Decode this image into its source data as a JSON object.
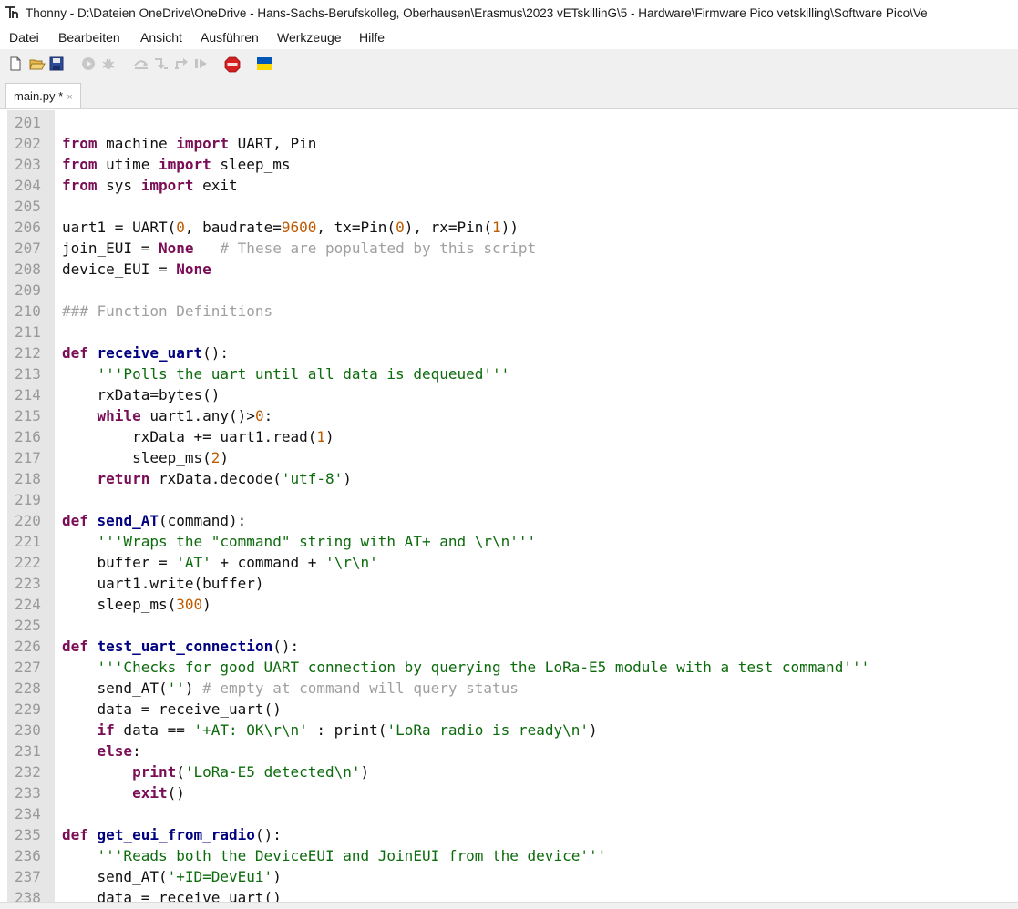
{
  "window": {
    "app_name": "Thonny",
    "title_path": "D:\\Dateien OneDrive\\OneDrive - Hans-Sachs-Berufskolleg, Oberhausen\\Erasmus\\2023 vETskillinG\\5 - Hardware\\Firmware Pico vetskilling\\Software Pico\\Ve",
    "separator": " - "
  },
  "menubar": {
    "items": [
      "Datei",
      "Bearbeiten",
      "Ansicht",
      "Ausführen",
      "Werkzeuge",
      "Hilfe"
    ]
  },
  "toolbar": {
    "icons": [
      "new-file",
      "open-file",
      "save",
      "run",
      "debug",
      "step-over",
      "step-into",
      "step-out",
      "resume",
      "stop",
      "ukraine-flag"
    ]
  },
  "tabs": [
    {
      "label": "main.py *",
      "close": "×",
      "active": true
    }
  ],
  "editor": {
    "lines": [
      {
        "n": "201",
        "tokens": []
      },
      {
        "n": "202",
        "tokens": [
          [
            "kw",
            "from"
          ],
          [
            "plain",
            " machine "
          ],
          [
            "kw",
            "import"
          ],
          [
            "plain",
            " UART, Pin"
          ]
        ]
      },
      {
        "n": "203",
        "tokens": [
          [
            "kw",
            "from"
          ],
          [
            "plain",
            " utime "
          ],
          [
            "kw",
            "import"
          ],
          [
            "plain",
            " sleep_ms"
          ]
        ]
      },
      {
        "n": "204",
        "tokens": [
          [
            "kw",
            "from"
          ],
          [
            "plain",
            " sys "
          ],
          [
            "kw",
            "import"
          ],
          [
            "plain",
            " exit"
          ]
        ]
      },
      {
        "n": "205",
        "tokens": []
      },
      {
        "n": "206",
        "tokens": [
          [
            "plain",
            "uart1 = UART("
          ],
          [
            "num",
            "0"
          ],
          [
            "plain",
            ", baudrate="
          ],
          [
            "num",
            "9600"
          ],
          [
            "plain",
            ", tx=Pin("
          ],
          [
            "num",
            "0"
          ],
          [
            "plain",
            "), rx=Pin("
          ],
          [
            "num",
            "1"
          ],
          [
            "plain",
            "))"
          ]
        ]
      },
      {
        "n": "207",
        "tokens": [
          [
            "plain",
            "join_EUI = "
          ],
          [
            "kw",
            "None"
          ],
          [
            "plain",
            "   "
          ],
          [
            "cmt",
            "# These are populated by this script"
          ]
        ]
      },
      {
        "n": "208",
        "tokens": [
          [
            "plain",
            "device_EUI = "
          ],
          [
            "kw",
            "None"
          ]
        ]
      },
      {
        "n": "209",
        "tokens": []
      },
      {
        "n": "210",
        "tokens": [
          [
            "cmt",
            "### Function Definitions"
          ]
        ]
      },
      {
        "n": "211",
        "tokens": []
      },
      {
        "n": "212",
        "tokens": [
          [
            "kw",
            "def"
          ],
          [
            "plain",
            " "
          ],
          [
            "fn",
            "receive_uart"
          ],
          [
            "plain",
            "():"
          ]
        ]
      },
      {
        "n": "213",
        "tokens": [
          [
            "plain",
            "    "
          ],
          [
            "str",
            "'''Polls the uart until all data is dequeued'''"
          ]
        ]
      },
      {
        "n": "214",
        "tokens": [
          [
            "plain",
            "    rxData=bytes()"
          ]
        ]
      },
      {
        "n": "215",
        "tokens": [
          [
            "plain",
            "    "
          ],
          [
            "kw",
            "while"
          ],
          [
            "plain",
            " uart1.any()>"
          ],
          [
            "num",
            "0"
          ],
          [
            "plain",
            ":"
          ]
        ]
      },
      {
        "n": "216",
        "tokens": [
          [
            "plain",
            "        rxData += uart1.read("
          ],
          [
            "num",
            "1"
          ],
          [
            "plain",
            ")"
          ]
        ]
      },
      {
        "n": "217",
        "tokens": [
          [
            "plain",
            "        sleep_ms("
          ],
          [
            "num",
            "2"
          ],
          [
            "plain",
            ")"
          ]
        ]
      },
      {
        "n": "218",
        "tokens": [
          [
            "plain",
            "    "
          ],
          [
            "kw",
            "return"
          ],
          [
            "plain",
            " rxData.decode("
          ],
          [
            "str",
            "'utf-8'"
          ],
          [
            "plain",
            ")"
          ]
        ]
      },
      {
        "n": "219",
        "tokens": []
      },
      {
        "n": "220",
        "tokens": [
          [
            "kw",
            "def"
          ],
          [
            "plain",
            " "
          ],
          [
            "fn",
            "send_AT"
          ],
          [
            "plain",
            "(command):"
          ]
        ]
      },
      {
        "n": "221",
        "tokens": [
          [
            "plain",
            "    "
          ],
          [
            "str",
            "'''Wraps the \"command\" string with AT+ and \\r\\n'''"
          ]
        ]
      },
      {
        "n": "222",
        "tokens": [
          [
            "plain",
            "    buffer = "
          ],
          [
            "str",
            "'AT'"
          ],
          [
            "plain",
            " + command + "
          ],
          [
            "str",
            "'\\r\\n'"
          ]
        ]
      },
      {
        "n": "223",
        "tokens": [
          [
            "plain",
            "    uart1.write(buffer)"
          ]
        ]
      },
      {
        "n": "224",
        "tokens": [
          [
            "plain",
            "    sleep_ms("
          ],
          [
            "num",
            "300"
          ],
          [
            "plain",
            ")"
          ]
        ]
      },
      {
        "n": "225",
        "tokens": []
      },
      {
        "n": "226",
        "tokens": [
          [
            "kw",
            "def"
          ],
          [
            "plain",
            " "
          ],
          [
            "fn",
            "test_uart_connection"
          ],
          [
            "plain",
            "():"
          ]
        ]
      },
      {
        "n": "227",
        "tokens": [
          [
            "plain",
            "    "
          ],
          [
            "str",
            "'''Checks for good UART connection by querying the LoRa-E5 module with a test command'''"
          ]
        ]
      },
      {
        "n": "228",
        "tokens": [
          [
            "plain",
            "    send_AT("
          ],
          [
            "str",
            "''"
          ],
          [
            "plain",
            ") "
          ],
          [
            "cmt",
            "# empty at command will query status"
          ]
        ]
      },
      {
        "n": "229",
        "tokens": [
          [
            "plain",
            "    data = receive_uart()"
          ]
        ]
      },
      {
        "n": "230",
        "tokens": [
          [
            "plain",
            "    "
          ],
          [
            "kw",
            "if"
          ],
          [
            "plain",
            " data == "
          ],
          [
            "str",
            "'+AT: OK\\r\\n'"
          ],
          [
            "plain",
            " : print("
          ],
          [
            "str",
            "'LoRa radio is ready\\n'"
          ],
          [
            "plain",
            ")"
          ]
        ]
      },
      {
        "n": "231",
        "tokens": [
          [
            "plain",
            "    "
          ],
          [
            "kw",
            "else"
          ],
          [
            "plain",
            ":"
          ]
        ]
      },
      {
        "n": "232",
        "tokens": [
          [
            "plain",
            "        "
          ],
          [
            "kw",
            "print"
          ],
          [
            "plain",
            "("
          ],
          [
            "str",
            "'LoRa-E5 detected\\n'"
          ],
          [
            "plain",
            ")"
          ]
        ]
      },
      {
        "n": "233",
        "tokens": [
          [
            "plain",
            "        "
          ],
          [
            "kw",
            "exit"
          ],
          [
            "plain",
            "()"
          ]
        ]
      },
      {
        "n": "234",
        "tokens": []
      },
      {
        "n": "235",
        "tokens": [
          [
            "kw",
            "def"
          ],
          [
            "plain",
            " "
          ],
          [
            "fn",
            "get_eui_from_radio"
          ],
          [
            "plain",
            "():"
          ]
        ]
      },
      {
        "n": "236",
        "tokens": [
          [
            "plain",
            "    "
          ],
          [
            "str",
            "'''Reads both the DeviceEUI and JoinEUI from the device'''"
          ]
        ]
      },
      {
        "n": "237",
        "tokens": [
          [
            "plain",
            "    send_AT("
          ],
          [
            "str",
            "'+ID=DevEui'"
          ],
          [
            "plain",
            ")"
          ]
        ]
      },
      {
        "n": "238",
        "tokens": [
          [
            "plain",
            "    data = receive_uart()"
          ]
        ]
      }
    ]
  },
  "colors": {
    "keyword": "#7a0d55",
    "function_name": "#000080",
    "number": "#c05a00",
    "string": "#0c6b0c",
    "comment": "#a0a0a0",
    "gutter_bg": "#e6e6e6",
    "line_number": "#999999"
  }
}
